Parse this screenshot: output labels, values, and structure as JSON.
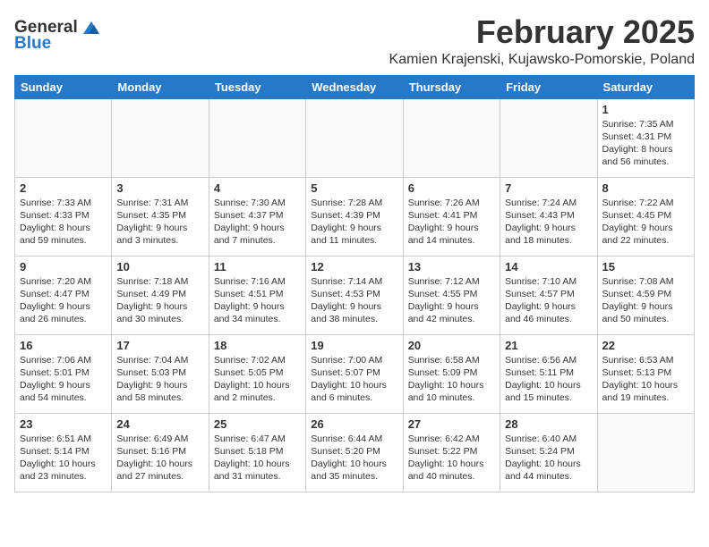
{
  "header": {
    "logo_general": "General",
    "logo_blue": "Blue",
    "month_title": "February 2025",
    "location": "Kamien Krajenski, Kujawsko-Pomorskie, Poland"
  },
  "weekdays": [
    "Sunday",
    "Monday",
    "Tuesday",
    "Wednesday",
    "Thursday",
    "Friday",
    "Saturday"
  ],
  "weeks": [
    [
      {
        "day": "",
        "info": ""
      },
      {
        "day": "",
        "info": ""
      },
      {
        "day": "",
        "info": ""
      },
      {
        "day": "",
        "info": ""
      },
      {
        "day": "",
        "info": ""
      },
      {
        "day": "",
        "info": ""
      },
      {
        "day": "1",
        "info": "Sunrise: 7:35 AM\nSunset: 4:31 PM\nDaylight: 8 hours and 56 minutes."
      }
    ],
    [
      {
        "day": "2",
        "info": "Sunrise: 7:33 AM\nSunset: 4:33 PM\nDaylight: 8 hours and 59 minutes."
      },
      {
        "day": "3",
        "info": "Sunrise: 7:31 AM\nSunset: 4:35 PM\nDaylight: 9 hours and 3 minutes."
      },
      {
        "day": "4",
        "info": "Sunrise: 7:30 AM\nSunset: 4:37 PM\nDaylight: 9 hours and 7 minutes."
      },
      {
        "day": "5",
        "info": "Sunrise: 7:28 AM\nSunset: 4:39 PM\nDaylight: 9 hours and 11 minutes."
      },
      {
        "day": "6",
        "info": "Sunrise: 7:26 AM\nSunset: 4:41 PM\nDaylight: 9 hours and 14 minutes."
      },
      {
        "day": "7",
        "info": "Sunrise: 7:24 AM\nSunset: 4:43 PM\nDaylight: 9 hours and 18 minutes."
      },
      {
        "day": "8",
        "info": "Sunrise: 7:22 AM\nSunset: 4:45 PM\nDaylight: 9 hours and 22 minutes."
      }
    ],
    [
      {
        "day": "9",
        "info": "Sunrise: 7:20 AM\nSunset: 4:47 PM\nDaylight: 9 hours and 26 minutes."
      },
      {
        "day": "10",
        "info": "Sunrise: 7:18 AM\nSunset: 4:49 PM\nDaylight: 9 hours and 30 minutes."
      },
      {
        "day": "11",
        "info": "Sunrise: 7:16 AM\nSunset: 4:51 PM\nDaylight: 9 hours and 34 minutes."
      },
      {
        "day": "12",
        "info": "Sunrise: 7:14 AM\nSunset: 4:53 PM\nDaylight: 9 hours and 38 minutes."
      },
      {
        "day": "13",
        "info": "Sunrise: 7:12 AM\nSunset: 4:55 PM\nDaylight: 9 hours and 42 minutes."
      },
      {
        "day": "14",
        "info": "Sunrise: 7:10 AM\nSunset: 4:57 PM\nDaylight: 9 hours and 46 minutes."
      },
      {
        "day": "15",
        "info": "Sunrise: 7:08 AM\nSunset: 4:59 PM\nDaylight: 9 hours and 50 minutes."
      }
    ],
    [
      {
        "day": "16",
        "info": "Sunrise: 7:06 AM\nSunset: 5:01 PM\nDaylight: 9 hours and 54 minutes."
      },
      {
        "day": "17",
        "info": "Sunrise: 7:04 AM\nSunset: 5:03 PM\nDaylight: 9 hours and 58 minutes."
      },
      {
        "day": "18",
        "info": "Sunrise: 7:02 AM\nSunset: 5:05 PM\nDaylight: 10 hours and 2 minutes."
      },
      {
        "day": "19",
        "info": "Sunrise: 7:00 AM\nSunset: 5:07 PM\nDaylight: 10 hours and 6 minutes."
      },
      {
        "day": "20",
        "info": "Sunrise: 6:58 AM\nSunset: 5:09 PM\nDaylight: 10 hours and 10 minutes."
      },
      {
        "day": "21",
        "info": "Sunrise: 6:56 AM\nSunset: 5:11 PM\nDaylight: 10 hours and 15 minutes."
      },
      {
        "day": "22",
        "info": "Sunrise: 6:53 AM\nSunset: 5:13 PM\nDaylight: 10 hours and 19 minutes."
      }
    ],
    [
      {
        "day": "23",
        "info": "Sunrise: 6:51 AM\nSunset: 5:14 PM\nDaylight: 10 hours and 23 minutes."
      },
      {
        "day": "24",
        "info": "Sunrise: 6:49 AM\nSunset: 5:16 PM\nDaylight: 10 hours and 27 minutes."
      },
      {
        "day": "25",
        "info": "Sunrise: 6:47 AM\nSunset: 5:18 PM\nDaylight: 10 hours and 31 minutes."
      },
      {
        "day": "26",
        "info": "Sunrise: 6:44 AM\nSunset: 5:20 PM\nDaylight: 10 hours and 35 minutes."
      },
      {
        "day": "27",
        "info": "Sunrise: 6:42 AM\nSunset: 5:22 PM\nDaylight: 10 hours and 40 minutes."
      },
      {
        "day": "28",
        "info": "Sunrise: 6:40 AM\nSunset: 5:24 PM\nDaylight: 10 hours and 44 minutes."
      },
      {
        "day": "",
        "info": ""
      }
    ]
  ]
}
